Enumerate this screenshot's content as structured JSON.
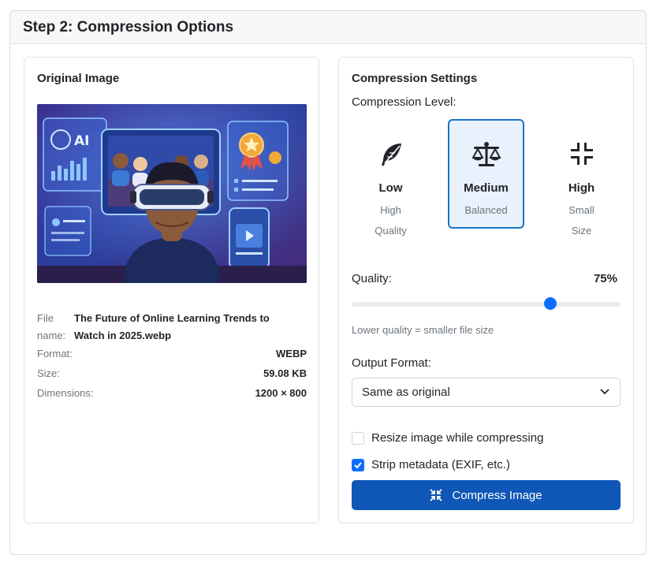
{
  "header": {
    "title": "Step 2: Compression Options"
  },
  "original": {
    "title": "Original Image",
    "file_name_label": "File name:",
    "file_name_label_line1": "File",
    "file_name_label_line2": "name:",
    "file_name_line1": "The Future of Online Learning Trends to",
    "file_name_line2": "Watch in 2025.webp",
    "format_label": "Format:",
    "format_value": "WEBP",
    "size_label": "Size:",
    "size_value": "59.08 KB",
    "dimensions_label": "Dimensions:",
    "dimensions_value": "1200 × 800",
    "image_ai_text": "AI"
  },
  "settings": {
    "title": "Compression Settings",
    "level_label": "Compression Level:",
    "levels": [
      {
        "name": "Low",
        "desc1": "High",
        "desc2": "Quality",
        "icon": "feather-icon",
        "selected": false
      },
      {
        "name": "Medium",
        "desc1": "Balanced",
        "desc2": "",
        "icon": "balance-scale-icon",
        "selected": true
      },
      {
        "name": "High",
        "desc1": "Small",
        "desc2": "Size",
        "icon": "compress-arrows-icon",
        "selected": false
      }
    ],
    "quality_label": "Quality:",
    "quality_value": "75%",
    "quality_fraction": 0.75,
    "quality_hint": "Lower quality = smaller file size",
    "format_label": "Output Format:",
    "format_selected": "Same as original",
    "resize_label": "Resize image while compressing",
    "resize_checked": false,
    "strip_label": "Strip metadata (EXIF, etc.)",
    "strip_checked": true,
    "compress_button": "Compress Image"
  },
  "colors": {
    "accent": "#0d6efd",
    "button": "#0f57b7",
    "selected_border": "#1a73c8",
    "selected_bg": "#e9f1fc"
  }
}
